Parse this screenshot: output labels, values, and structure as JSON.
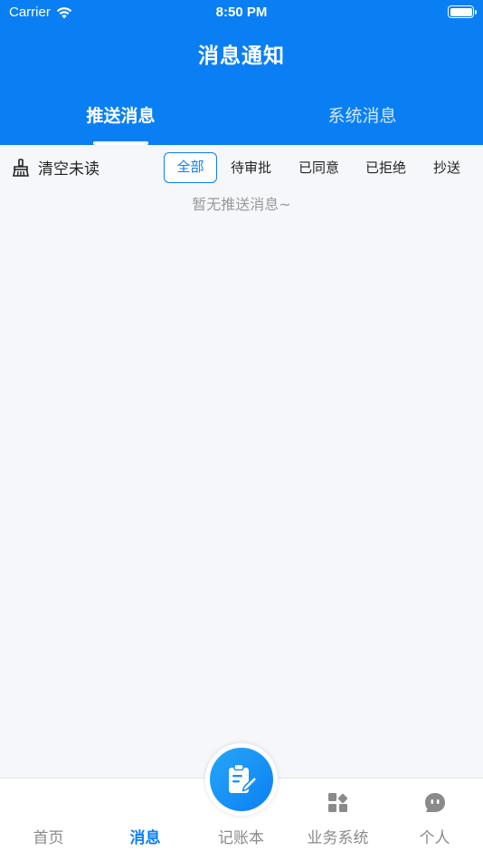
{
  "status_bar": {
    "carrier": "Carrier",
    "time": "8:50 PM"
  },
  "header": {
    "title": "消息通知"
  },
  "tabs": [
    {
      "label": "推送消息",
      "active": true
    },
    {
      "label": "系统消息",
      "active": false
    }
  ],
  "filter": {
    "clear_label": "清空未读",
    "chips": [
      "全部",
      "待审批",
      "已同意",
      "已拒绝",
      "抄送"
    ],
    "selected": "全部"
  },
  "empty_message": "暂无推送消息~",
  "tabbar": {
    "items": [
      {
        "label": "首页"
      },
      {
        "label": "消息",
        "active": true
      },
      {
        "label": "记账本"
      },
      {
        "label": "业务系统"
      },
      {
        "label": "个人"
      }
    ]
  },
  "colors": {
    "primary": "#0a7ff4",
    "background": "#f5f7fa",
    "muted": "#9a9a9a"
  },
  "icons": {
    "clear": "broom-icon",
    "fab": "clipboard-edit-icon",
    "business": "apps-grid-icon",
    "personal": "chat-face-icon"
  }
}
